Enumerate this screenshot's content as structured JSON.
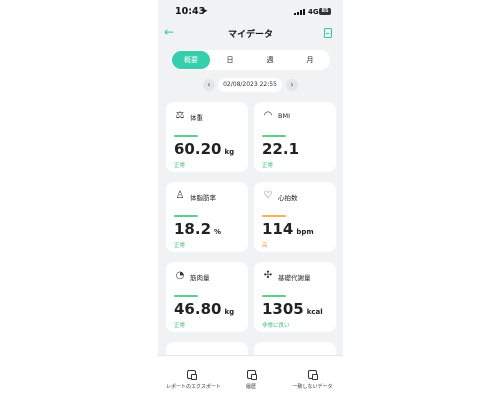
{
  "status_bar": {
    "time": "10:43",
    "network": "4G",
    "battery": "85"
  },
  "header": {
    "title": "マイデータ"
  },
  "tabs": [
    {
      "label": "概要",
      "active": true
    },
    {
      "label": "日",
      "active": false
    },
    {
      "label": "週",
      "active": false
    },
    {
      "label": "月",
      "active": false
    }
  ],
  "date_nav": {
    "date": "02/08/2023 22:55",
    "prev": "‹",
    "next": "›"
  },
  "cards": [
    {
      "label": "体重",
      "value": "60.20",
      "unit": "kg",
      "status": "正常",
      "status_color": "#2fbf71",
      "bar_color": "#5ccf86",
      "icon": "scale-icon",
      "glyph": "⚖"
    },
    {
      "label": "BMI",
      "value": "22.1",
      "unit": "",
      "status": "正常",
      "status_color": "#2fbf71",
      "bar_color": "#5ccf86",
      "icon": "gauge-icon",
      "glyph": "◠"
    },
    {
      "label": "体脂肪率",
      "value": "18.2",
      "unit": "%",
      "status": "正常",
      "status_color": "#2fbf71",
      "bar_color": "#5ccf86",
      "icon": "body-fat-icon",
      "glyph": "♙"
    },
    {
      "label": "心拍数",
      "value": "114",
      "unit": "bpm",
      "status": "高",
      "status_color": "#f0a040",
      "bar_color": "#f5b25a",
      "icon": "heartbeat-icon",
      "glyph": "♡"
    },
    {
      "label": "筋肉量",
      "value": "46.80",
      "unit": "kg",
      "status": "正常",
      "status_color": "#2fbf71",
      "bar_color": "#5ccf86",
      "icon": "muscle-icon",
      "glyph": "◔"
    },
    {
      "label": "基礎代謝量",
      "value": "1305",
      "unit": "kcal",
      "status": "非常に良い",
      "status_color": "#2fbf71",
      "bar_color": "#5ccf86",
      "icon": "metabolism-icon",
      "glyph": "✣"
    }
  ],
  "bottom_bar": [
    {
      "label": "レポートのエクスポート",
      "icon": "export-icon"
    },
    {
      "label": "履歴",
      "icon": "history-icon"
    },
    {
      "label": "一致しないデータ",
      "icon": "mismatch-data-icon"
    }
  ]
}
